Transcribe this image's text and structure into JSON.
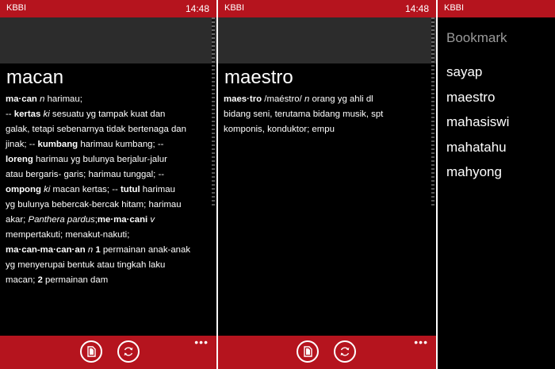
{
  "app_title": "KBBI",
  "time": "14:48",
  "colors": {
    "accent": "#b5141e",
    "background": "#000000",
    "header": "#2c2c2c"
  },
  "screen1": {
    "word": "macan",
    "definition": [
      {
        "t": "ma·can",
        "s": "b"
      },
      {
        "t": " "
      },
      {
        "t": "n",
        "s": "i"
      },
      {
        "t": " harimau;"
      },
      {
        "br": true
      },
      {
        "t": "-- "
      },
      {
        "t": "kertas",
        "s": "b"
      },
      {
        "t": " "
      },
      {
        "t": "ki",
        "s": "i"
      },
      {
        "t": " sesuatu yg tampak kuat dan"
      },
      {
        "br": true
      },
      {
        "t": "galak, tetapi sebenarnya tidak bertenaga dan"
      },
      {
        "br": true
      },
      {
        "t": "jinak; -- "
      },
      {
        "t": "kumbang",
        "s": "b"
      },
      {
        "t": " harimau kumbang; --"
      },
      {
        "br": true
      },
      {
        "t": "loreng",
        "s": "b"
      },
      {
        "t": " harimau yg bulunya berjalur-jalur"
      },
      {
        "br": true
      },
      {
        "t": "atau bergaris- garis; harimau tunggal; --"
      },
      {
        "br": true
      },
      {
        "t": "ompong",
        "s": "b"
      },
      {
        "t": " "
      },
      {
        "t": "ki",
        "s": "i"
      },
      {
        "t": " macan kertas; -- "
      },
      {
        "t": "tutul",
        "s": "b"
      },
      {
        "t": " harimau"
      },
      {
        "br": true
      },
      {
        "t": "yg bulunya bebercak-bercak hitam; harimau"
      },
      {
        "br": true
      },
      {
        "t": "akar; "
      },
      {
        "t": "Panthera pardus",
        "s": "i"
      },
      {
        "t": ";"
      },
      {
        "t": "me·ma·cani",
        "s": "b"
      },
      {
        "t": " "
      },
      {
        "t": "v",
        "s": "i"
      },
      {
        "br": true
      },
      {
        "t": "mempertakuti; menakut-nakuti;"
      },
      {
        "br": true
      },
      {
        "t": "ma·can-ma·can·an",
        "s": "b"
      },
      {
        "t": " "
      },
      {
        "t": "n",
        "s": "i"
      },
      {
        "t": " "
      },
      {
        "t": "1",
        "s": "b"
      },
      {
        "t": " permainan anak-anak"
      },
      {
        "br": true
      },
      {
        "t": "yg menyerupai bentuk atau tingkah laku"
      },
      {
        "br": true
      },
      {
        "t": "macan; "
      },
      {
        "t": "2",
        "s": "b"
      },
      {
        "t": " permainan dam"
      }
    ]
  },
  "screen2": {
    "word": "maestro",
    "definition": [
      {
        "t": "maes·tro",
        "s": "b"
      },
      {
        "t": " /maéstro/ "
      },
      {
        "t": "n",
        "s": "i"
      },
      {
        "t": " orang yg ahli dl"
      },
      {
        "br": true
      },
      {
        "t": "bidang seni, terutama bidang musik, spt"
      },
      {
        "br": true
      },
      {
        "t": "komponis, konduktor; empu"
      }
    ]
  },
  "screen3": {
    "title": "Bookmark",
    "items": [
      "sayap",
      "maestro",
      "mahasiswi",
      "mahatahu",
      "mahyong"
    ]
  },
  "appbar": {
    "copy_icon": "document-copy-icon",
    "refresh_icon": "sync-icon",
    "more_label": "•••"
  }
}
